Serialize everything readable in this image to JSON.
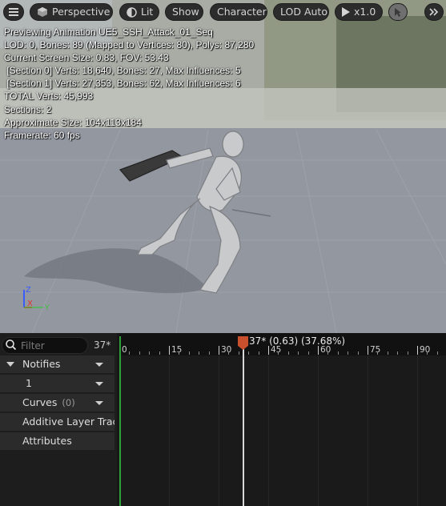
{
  "toolbar": {
    "perspective_label": "Perspective",
    "lit_label": "Lit",
    "show_label": "Show",
    "character_label": "Character",
    "lod_label": "LOD Auto",
    "speed_label": "x1.0"
  },
  "stats": {
    "line1": "Previewing Animation UE5_SSH_Attack_01_Seq",
    "line2": "LOD: 0, Bones: 89 (Mapped to Vertices: 80), Polys: 87,280",
    "line3": "Current Screen Size: 0.83, FOV: 53.43",
    "line4": " [Section 0] Verts: 18,640, Bones: 27, Max Influences: 5",
    "line5": " [Section 1] Verts: 27,353, Bones: 62, Max Influences: 6",
    "line6": "TOTAL Verts: 45,993",
    "line7": "Sections: 2",
    "line8": "Approximate Size: 104x113x184",
    "line9": "Framerate: 60 fps"
  },
  "axes": {
    "z": "Z",
    "x": "X",
    "y": "Y"
  },
  "panel": {
    "filter_placeholder": "Filter",
    "current_frame": "37*",
    "tracks": {
      "notifies": "Notifies",
      "notify_track": "1",
      "curves": "Curves",
      "curves_count": "(0)",
      "additive": "Additive Layer Trac",
      "attributes": "Attributes"
    },
    "playhead_label": "37* (0.63) (37.68%)",
    "ruler_labels": [
      "0",
      "15",
      "30",
      "45",
      "60",
      "75",
      "90"
    ],
    "playhead_frame": 37
  },
  "colors": {
    "playhead": "#c8502c",
    "start_marker": "#2ea03a",
    "axis_x": "#e0322e",
    "axis_y": "#3cc43c",
    "axis_z": "#3a5cff"
  }
}
